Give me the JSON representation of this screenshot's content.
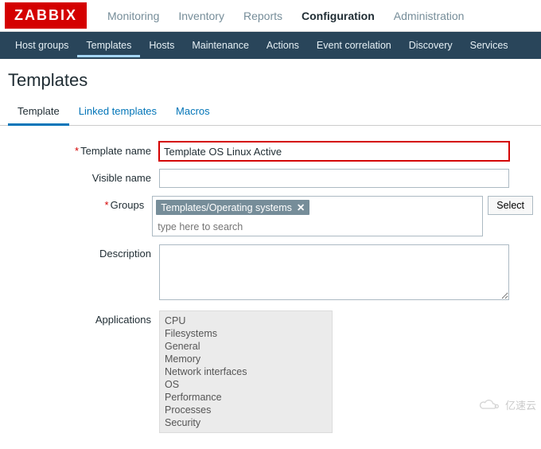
{
  "brand": "ZABBIX",
  "topNav": {
    "items": [
      "Monitoring",
      "Inventory",
      "Reports",
      "Configuration",
      "Administration"
    ],
    "activeIndex": 3
  },
  "subNav": {
    "items": [
      "Host groups",
      "Templates",
      "Hosts",
      "Maintenance",
      "Actions",
      "Event correlation",
      "Discovery",
      "Services"
    ],
    "activeIndex": 1
  },
  "pageTitle": "Templates",
  "tabs": {
    "items": [
      "Template",
      "Linked templates",
      "Macros"
    ],
    "activeIndex": 0
  },
  "form": {
    "templateName": {
      "label": "Template name",
      "value": "Template OS Linux Active",
      "required": true
    },
    "visibleName": {
      "label": "Visible name",
      "value": "",
      "required": false
    },
    "groups": {
      "label": "Groups",
      "required": true,
      "tags": [
        "Templates/Operating systems"
      ],
      "placeholder": "type here to search",
      "selectBtn": "Select"
    },
    "description": {
      "label": "Description",
      "value": ""
    },
    "applications": {
      "label": "Applications",
      "items": [
        "CPU",
        "Filesystems",
        "General",
        "Memory",
        "Network interfaces",
        "OS",
        "Performance",
        "Processes",
        "Security"
      ]
    }
  },
  "watermark": "亿速云"
}
